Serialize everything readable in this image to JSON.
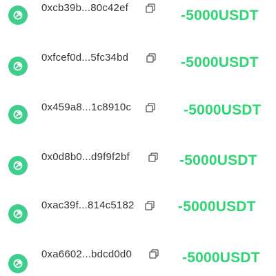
{
  "colors": {
    "accent": "#3ecf8e",
    "amount": "#2ed573",
    "text": "#333333"
  },
  "transactions": [
    {
      "address": "0xcb39b...80c42ef",
      "amount": "-5000USDT",
      "icon": "outgoing-arrow-icon"
    },
    {
      "address": "0xfcef0d...5fc34bd",
      "amount": "-5000USDT",
      "icon": "outgoing-arrow-icon"
    },
    {
      "address": "0x459a8...1c8910c",
      "amount": "-5000USDT",
      "icon": "outgoing-arrow-icon"
    },
    {
      "address": "0x0d8b0...d9f9f2bf",
      "amount": "-5000USDT",
      "icon": "outgoing-arrow-icon"
    },
    {
      "address": "0xac39f...814c5182",
      "amount": "-5000USDT",
      "icon": "outgoing-arrow-icon"
    },
    {
      "address": "0xa6602...bdcd0d0",
      "amount": "-5000USDT",
      "icon": "outgoing-arrow-icon"
    }
  ]
}
